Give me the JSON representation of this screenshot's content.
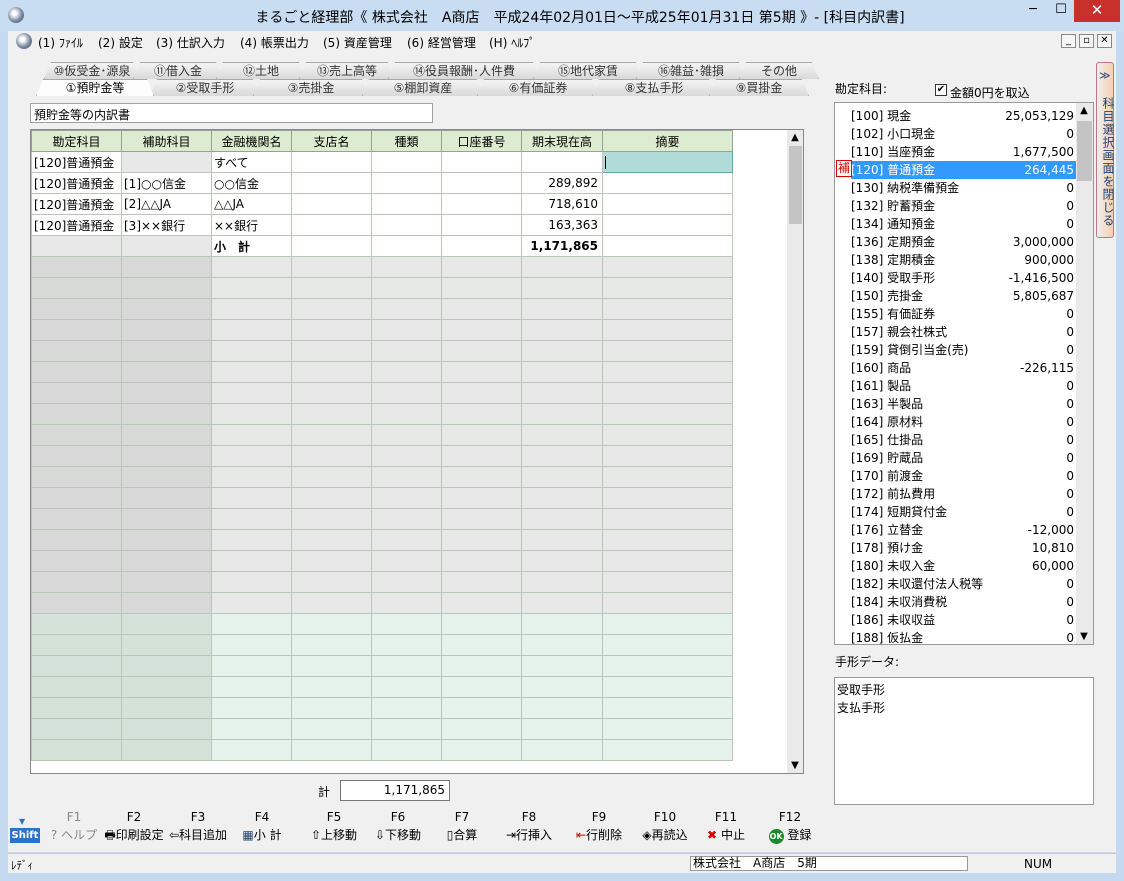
{
  "window": {
    "title": "まるごと経理部《 株式会社　A商店　平成24年02月01日～平成25年01月31日 第5期 》- [科目内訳書]",
    "min": "─",
    "max": "☐",
    "close": "✕"
  },
  "menu": {
    "items": [
      "(1) ﾌｧｲﾙ",
      "(2) 設定",
      "(3) 仕訳入力",
      "(4) 帳票出力",
      "(5) 資産管理",
      "(6) 経営管理",
      "(H) ﾍﾙﾌﾟ"
    ],
    "mdi_min": "_",
    "mdi_restore": "▫",
    "mdi_close": "✕"
  },
  "tabs_back": [
    "⑩仮受金･源泉",
    "⑪借入金",
    "⑫土地",
    "⑬売上高等",
    "⑭役員報酬･人件費",
    "⑮地代家賃",
    "⑯雑益･雑損",
    "その他"
  ],
  "tabs_front": [
    "①預貯金等",
    "②受取手形",
    "③売掛金",
    "⑤棚卸資産",
    "⑥有価証券",
    "⑧支払手形",
    "⑨買掛金"
  ],
  "page_title": "預貯金等の内訳書",
  "grid": {
    "headers": [
      "勘定科目",
      "補助科目",
      "金融機関名",
      "支店名",
      "種類",
      "口座番号",
      "期末現在高",
      "摘要"
    ],
    "rows": [
      [
        "[120]普通預金",
        "",
        "すべて",
        "",
        "",
        "",
        "",
        ""
      ],
      [
        "[120]普通預金",
        "[1]○○信金",
        "○○信金",
        "",
        "",
        "",
        "289,892",
        ""
      ],
      [
        "[120]普通預金",
        "[2]△△JA",
        "△△JA",
        "",
        "",
        "",
        "718,610",
        ""
      ],
      [
        "[120]普通預金",
        "[3]××銀行",
        "××銀行",
        "",
        "",
        "",
        "163,363",
        ""
      ],
      [
        "",
        "",
        "小　計",
        "",
        "",
        "",
        "1,171,865",
        ""
      ]
    ]
  },
  "total": {
    "label": "計",
    "value": "1,171,865"
  },
  "scroll": {
    "up": "▲",
    "down": "▼"
  },
  "acct_panel": {
    "label": "勘定科目:",
    "zero_check": "✔",
    "zero_label": "金額0円を取込",
    "aux_mark": "補",
    "items": [
      {
        "name": "[100] 現金",
        "value": "25,053,129"
      },
      {
        "name": "[102] 小口現金",
        "value": "0"
      },
      {
        "name": "[110] 当座預金",
        "value": "1,677,500"
      },
      {
        "name": "[120] 普通預金",
        "value": "264,445"
      },
      {
        "name": "[130] 納税準備預金",
        "value": "0"
      },
      {
        "name": "[132] 貯蓄預金",
        "value": "0"
      },
      {
        "name": "[134] 通知預金",
        "value": "0"
      },
      {
        "name": "[136] 定期預金",
        "value": "3,000,000"
      },
      {
        "name": "[138] 定期積金",
        "value": "900,000"
      },
      {
        "name": "[140] 受取手形",
        "value": "-1,416,500"
      },
      {
        "name": "[150] 売掛金",
        "value": "5,805,687"
      },
      {
        "name": "[155] 有価証券",
        "value": "0"
      },
      {
        "name": "[157] 親会社株式",
        "value": "0"
      },
      {
        "name": "[159] 貸倒引当金(売)",
        "value": "0"
      },
      {
        "name": "[160] 商品",
        "value": "-226,115"
      },
      {
        "name": "[161] 製品",
        "value": "0"
      },
      {
        "name": "[163] 半製品",
        "value": "0"
      },
      {
        "name": "[164] 原材料",
        "value": "0"
      },
      {
        "name": "[165] 仕掛品",
        "value": "0"
      },
      {
        "name": "[169] 貯蔵品",
        "value": "0"
      },
      {
        "name": "[170] 前渡金",
        "value": "0"
      },
      {
        "name": "[172] 前払費用",
        "value": "0"
      },
      {
        "name": "[174] 短期貸付金",
        "value": "0"
      },
      {
        "name": "[176] 立替金",
        "value": "-12,000"
      },
      {
        "name": "[178] 預け金",
        "value": "10,810"
      },
      {
        "name": "[180] 未収入金",
        "value": "60,000"
      },
      {
        "name": "[182] 未収還付法人税等",
        "value": "0"
      },
      {
        "name": "[184] 未収消費税",
        "value": "0"
      },
      {
        "name": "[186] 未収収益",
        "value": "0"
      },
      {
        "name": "[188] 仮払金",
        "value": "0"
      }
    ]
  },
  "notes_panel": {
    "label": "手形データ:",
    "items": [
      "受取手形",
      "支払手形"
    ]
  },
  "side_toggle": {
    "arrow": "≫",
    "text": "科目選択画面を閉じる"
  },
  "fkeys": [
    {
      "key": "F1",
      "label": "? ヘルプ"
    },
    {
      "key": "F2",
      "label": "印刷設定"
    },
    {
      "key": "F3",
      "label": "科目追加"
    },
    {
      "key": "F4",
      "label": "小 計"
    },
    {
      "key": "F5",
      "label": "⇧上移動"
    },
    {
      "key": "F6",
      "label": "⇩下移動"
    },
    {
      "key": "F7",
      "label": "合算"
    },
    {
      "key": "F8",
      "label": "行挿入"
    },
    {
      "key": "F9",
      "label": "行削除"
    },
    {
      "key": "F10",
      "label": "再読込"
    },
    {
      "key": "F11",
      "label": "中止"
    },
    {
      "key": "F12",
      "label": "登録"
    }
  ],
  "fkey_icons": [
    "",
    "🖶",
    "⇦",
    "▦",
    "",
    "",
    "▯",
    "⇥",
    "⇤",
    "◈",
    "✖",
    "OK"
  ],
  "shift": {
    "label": "Shift",
    "arrow": "▼"
  },
  "status": {
    "ready": "ﾚﾃﾞｨ",
    "company": "株式会社　A商店　5期",
    "num": "NUM"
  }
}
